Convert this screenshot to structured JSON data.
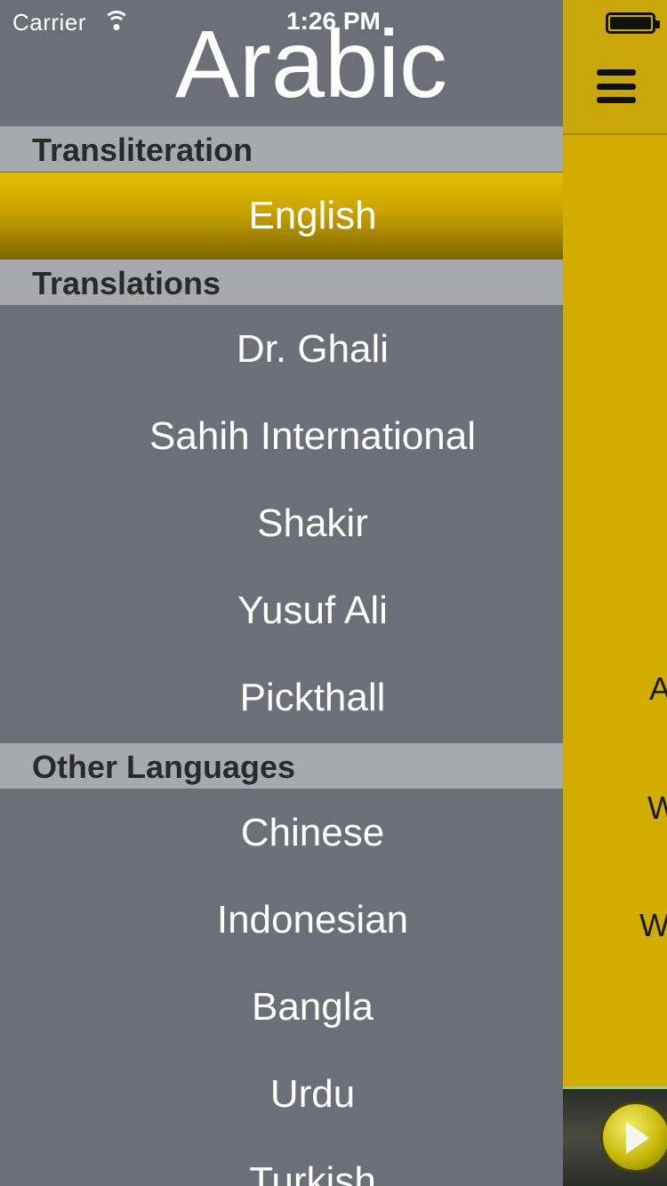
{
  "status": {
    "carrier": "Carrier",
    "time": "1:26 PM"
  },
  "drawer": {
    "title": "Arabic",
    "sections": [
      {
        "header": "Transliteration",
        "items": [
          "English"
        ]
      },
      {
        "header": "Translations",
        "items": [
          "Dr. Ghali",
          "Sahih International",
          "Shakir",
          "Yusuf Ali",
          "Pickthall"
        ]
      },
      {
        "header": "Other Languages",
        "items": [
          "Chinese",
          "Indonesian",
          "Bangla",
          "Urdu",
          "Turkish"
        ]
      }
    ],
    "selected_item": "English"
  },
  "main": {
    "peek_text": [
      "A",
      "W",
      "W"
    ]
  },
  "colors": {
    "accent": "#d2ad00",
    "drawer_bg": "#6c6f78",
    "section_bg": "#a8a9ae"
  }
}
